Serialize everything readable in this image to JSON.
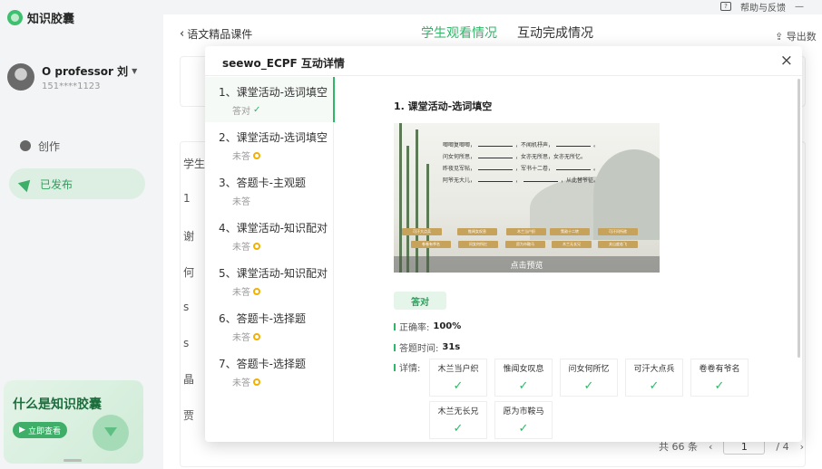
{
  "app": {
    "name": "知识胶囊",
    "help_label": "帮助与反馈",
    "minimize_label": "—"
  },
  "user": {
    "name": "O professor 刘",
    "phone": "151****1123"
  },
  "nav": {
    "create": "创作",
    "published": "已发布"
  },
  "promo": {
    "title": "什么是知识胶囊",
    "button": "立即查看"
  },
  "header": {
    "back_label": "语文精品课件",
    "tabs": [
      {
        "label": "学生观看情况",
        "active": true
      },
      {
        "label": "互动完成情况",
        "active": false
      }
    ],
    "export_label": "导出数"
  },
  "background": {
    "fragments": [
      "学生",
      "1",
      "谢",
      "何",
      "s",
      "s",
      "晶",
      "贾"
    ],
    "pagination": {
      "total": "共 66 条",
      "prev": "‹",
      "current": "1",
      "of": "/ 4",
      "next": "›"
    }
  },
  "modal": {
    "title": "seewo_ECPF 互动详情",
    "close_label": "×",
    "items": [
      {
        "title": "1、课堂活动-选词填空",
        "status": "答对",
        "state": "correct"
      },
      {
        "title": "2、课堂活动-选词填空",
        "status": "未答",
        "state": "pending"
      },
      {
        "title": "3、答题卡-主观题",
        "status": "未答",
        "state": "none"
      },
      {
        "title": "4、课堂活动-知识配对",
        "status": "未答",
        "state": "pending"
      },
      {
        "title": "5、课堂活动-知识配对",
        "status": "未答",
        "state": "pending"
      },
      {
        "title": "6、答题卡-选择题",
        "status": "未答",
        "state": "pending"
      },
      {
        "title": "7、答题卡-选择题",
        "status": "未答",
        "state": "pending"
      }
    ],
    "detail": {
      "title": "1. 课堂活动-选词填空",
      "preview_label": "点击预览",
      "poem_lines": [
        [
          "唧唧复唧唧，",
          "，不闻机杼声，",
          "。"
        ],
        [
          "问女何所思，",
          "，女亦无所思，女亦无所忆。"
        ],
        [
          "昨夜见军帖，",
          "，军书十二卷，",
          "。"
        ],
        [
          "阿爷无大儿，",
          "，",
          "，从此替爷征。"
        ]
      ],
      "word_bank": [
        "可汗大点兵",
        "惟闻女叹息",
        "木兰当户织",
        "策勋十二转",
        "可汗问所欲",
        "卷卷有爷名",
        "问女何所忆",
        "愿为市鞍马",
        "木兰无长兄",
        "关山度若飞"
      ],
      "result_label": "答对",
      "accuracy_label": "正确率:",
      "accuracy_value": "100%",
      "time_label": "答题时间:",
      "time_value": "31s",
      "details_label": "详情:",
      "answers": [
        "木兰当户织",
        "惟闻女叹息",
        "问女何所忆",
        "可汗大点兵",
        "卷卷有爷名",
        "木兰无长兄",
        "愿为市鞍马"
      ],
      "check_glyph": "✓"
    }
  },
  "colors": {
    "accent": "#2fb667",
    "pending": "#f2b000",
    "word_chip": "#c7a25a"
  }
}
